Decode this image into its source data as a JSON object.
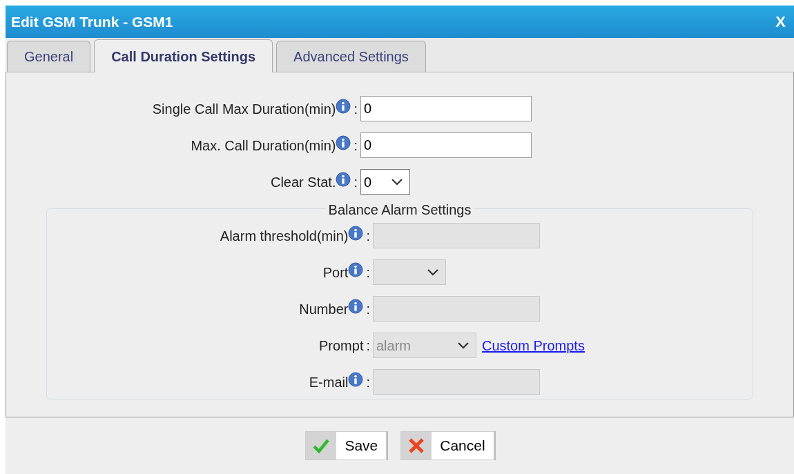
{
  "window": {
    "title": "Edit GSM Trunk - GSM1",
    "close": "X"
  },
  "tabs": [
    {
      "label": "General",
      "selected": false
    },
    {
      "label": "Call Duration Settings",
      "selected": true
    },
    {
      "label": "Advanced Settings",
      "selected": false
    }
  ],
  "fields": [
    {
      "label": "Single Call Max Duration(min)",
      "info": true,
      "colon": ":",
      "kind": "text",
      "value": "0",
      "disabled": false
    },
    {
      "label": "Max. Call Duration(min)",
      "info": true,
      "colon": ":",
      "kind": "text",
      "value": "0",
      "disabled": false
    },
    {
      "label": "Clear Stat.",
      "info": true,
      "colon": ":",
      "kind": "select",
      "value": "0",
      "disabled": false
    }
  ],
  "balance_alarm": {
    "legend": "Balance Alarm Settings",
    "fields": [
      {
        "label": "Alarm threshold(min)",
        "info": true,
        "colon": ":",
        "kind": "text",
        "disabled": true
      },
      {
        "label": "Port",
        "info": true,
        "colon": ":",
        "kind": "select",
        "disabled": true
      },
      {
        "label": "Number",
        "info": true,
        "colon": ":",
        "kind": "text",
        "disabled": true
      },
      {
        "label": "Prompt",
        "info": false,
        "colon": ":",
        "kind": "select",
        "value": "alarm",
        "disabled": true,
        "link": "Custom Prompts"
      },
      {
        "label": "E-mail",
        "info": true,
        "colon": ":",
        "kind": "text",
        "disabled": true
      }
    ]
  },
  "buttons": [
    {
      "label": "Save",
      "kind": "save"
    },
    {
      "label": "Cancel",
      "kind": "cancel"
    }
  ]
}
